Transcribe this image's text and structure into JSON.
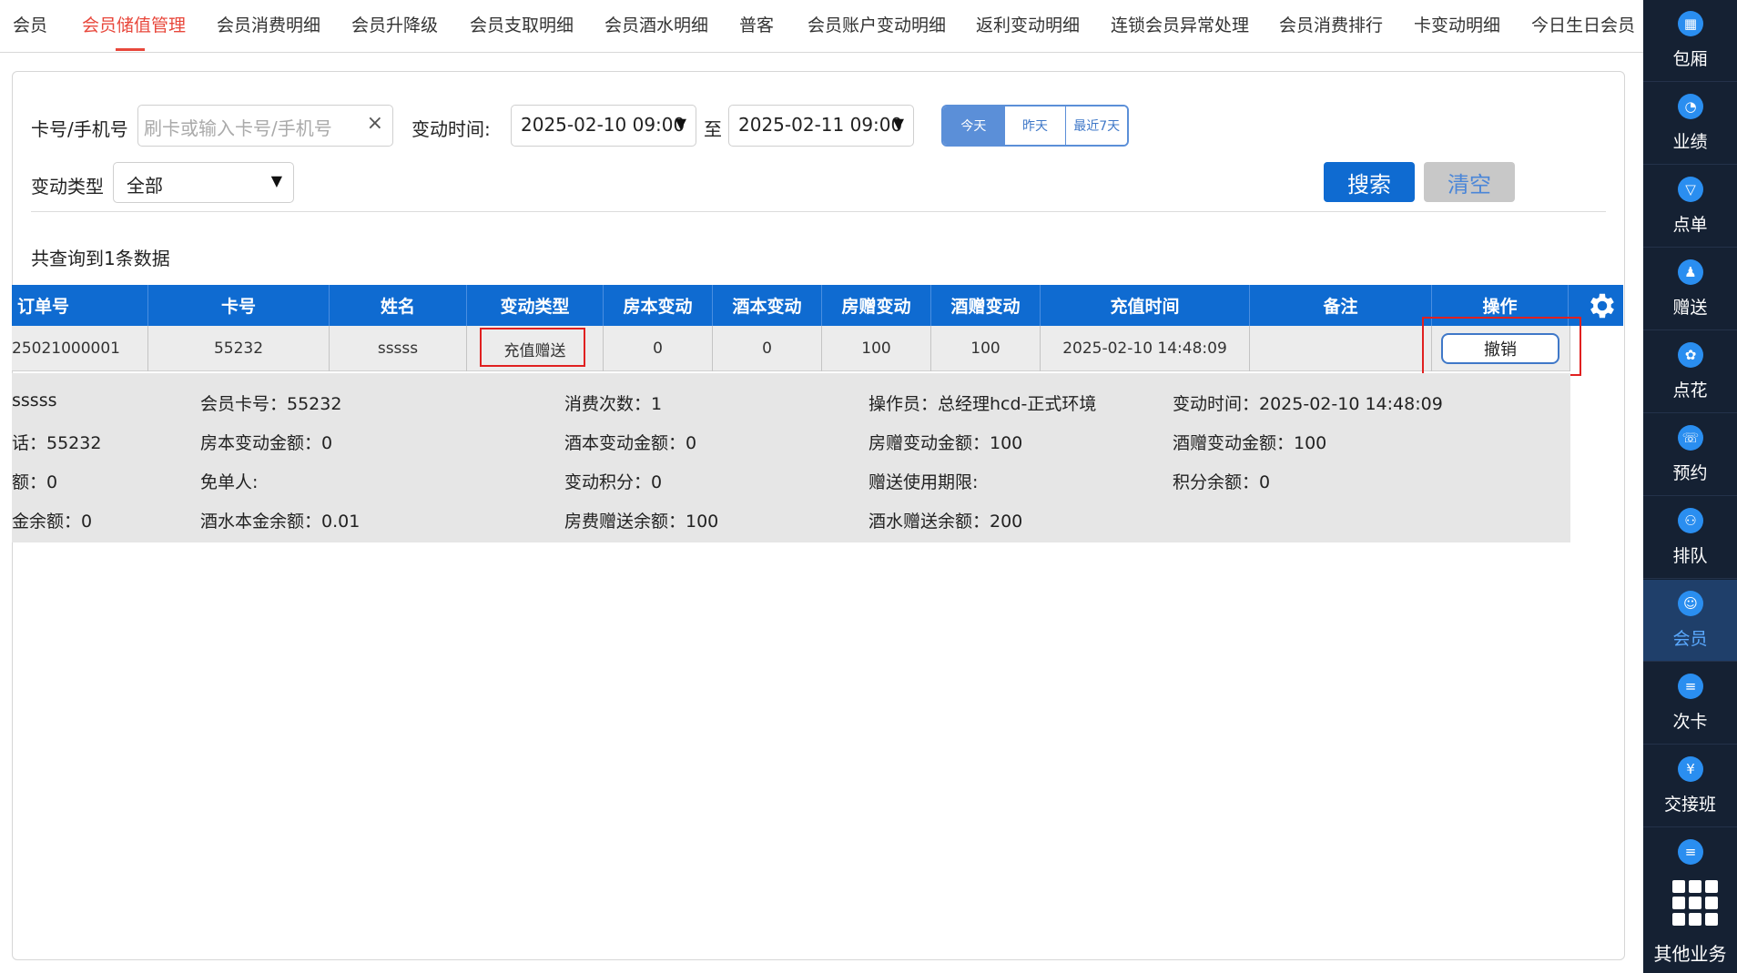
{
  "tabs": [
    "会员",
    "会员储值管理",
    "会员消费明细",
    "会员升降级",
    "会员支取明细",
    "会员酒水明细",
    "普客",
    "会员账户变动明细",
    "返利变动明细",
    "连锁会员异常处理",
    "会员消费排行",
    "卡变动明细",
    "今日生日会员"
  ],
  "active_tab_index": 1,
  "filters": {
    "card_label": "卡号/手机号",
    "card_placeholder": "刷卡或输入卡号/手机号",
    "clear_glyph": "×",
    "time_label": "变动时间:",
    "time_from": "2025-02-10 09:00",
    "time_sep": "至",
    "time_to": "2025-02-11 09:00",
    "quick_today": "今天",
    "quick_yesterday": "昨天",
    "quick_7days": "最近7天",
    "type_label": "变动类型",
    "type_value": "全部",
    "search": "搜索",
    "clear": "清空"
  },
  "result_text": "共查询到1条数据",
  "table": {
    "headers": [
      "订单号",
      "卡号",
      "姓名",
      "变动类型",
      "房本变动",
      "酒本变动",
      "房赠变动",
      "酒赠变动",
      "充值时间",
      "备注",
      "操作"
    ],
    "row": [
      "25021000001",
      "55232",
      "sssss",
      "充值赠送",
      "0",
      "0",
      "100",
      "100",
      "2025-02-10 14:48:09",
      ""
    ],
    "action": "撤销"
  },
  "detail": [
    [
      "sssss",
      "会员卡号：55232",
      "消费次数：1",
      "操作员：总经理hcd-正式环境",
      "变动时间：2025-02-10 14:48:09"
    ],
    [
      "话：55232",
      "房本变动金额：0",
      "酒本变动金额：0",
      "房赠变动金额：100",
      "酒赠变动金额：100"
    ],
    [
      "额：0",
      "免单人:",
      "变动积分：0",
      "赠送使用期限:",
      "积分余额：0"
    ],
    [
      "金余额：0",
      "酒水本金余额：0.01",
      "房费赠送余额：100",
      "酒水赠送余额：200",
      ""
    ]
  ],
  "sidebar": [
    "包厢",
    "业绩",
    "点单",
    "赠送",
    "点花",
    "预约",
    "排队",
    "会员",
    "次卡",
    "交接班"
  ],
  "sidebar_active_index": 7,
  "sidebar_more": "其他业务",
  "colors": {
    "primary": "#0f6bd1",
    "active_tab": "#e8473b",
    "sidebar_bg": "#152133",
    "highlight_box": "#e02020"
  }
}
